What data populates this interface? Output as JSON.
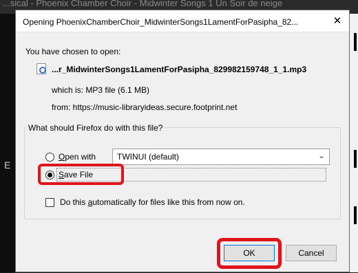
{
  "background": {
    "window_title": "...sical - Phoenix Chamber Choir - Midwinter Songs 1 Un Soir de neige"
  },
  "dialog": {
    "title": "Opening PhoenixChamberChoir_MidwinterSongs1LamentForPasipha_82...",
    "close_glyph": "✕",
    "chosen_label": "You have chosen to open:",
    "filename": "...r_MidwinterSongs1LamentForPasipha_829982159748_1_1.mp3",
    "which_is": "which is:  MP3 file (6.1 MB)",
    "from": "from:  https://music-libraryideas.secure.footprint.net",
    "group_label": "What should Firefox do with this file?",
    "open_with": {
      "label_prefix": "",
      "label_accel": "O",
      "label_rest": "pen with",
      "selected": "TWINUI (default)",
      "checked": false
    },
    "save_file": {
      "label_accel": "S",
      "label_rest": "ave File",
      "checked": true
    },
    "auto_checkbox": {
      "label_prefix": "Do this ",
      "label_accel": "a",
      "label_rest": "utomatically for files like this from now on.",
      "checked": false
    },
    "ok_label": "OK",
    "cancel_label": "Cancel"
  },
  "highlight_color": "#e0141b"
}
